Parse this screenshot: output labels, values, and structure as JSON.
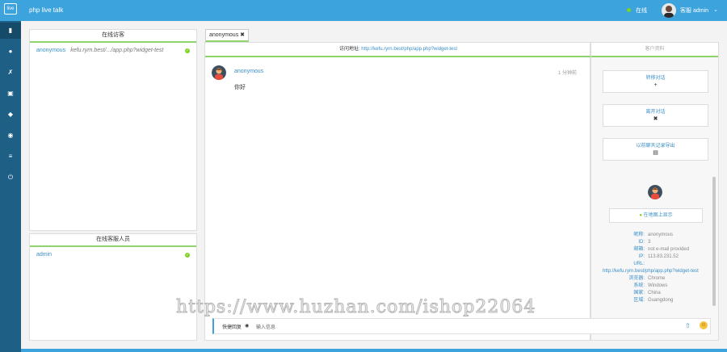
{
  "topbar": {
    "logo": "live",
    "title": "php live talk",
    "status": "在线",
    "user": "客服 admin",
    "status_color": "#7ed321"
  },
  "rail": {
    "icons": [
      "chat-icon",
      "map-marker-icon",
      "wrench-icon",
      "image-icon",
      "tag-icon",
      "eye-icon",
      "list-icon",
      "power-icon"
    ]
  },
  "visitors_panel": {
    "title": "在线访客",
    "items": [
      {
        "name": "anonymous",
        "url": "kefu.ryrn.best/.../app.php?widget-test"
      }
    ]
  },
  "staff_panel": {
    "title": "在线客服人员",
    "items": [
      {
        "name": "admin"
      }
    ]
  },
  "tab": {
    "label": "anonymous",
    "close": "✖"
  },
  "chat": {
    "address_label": "访问地址:",
    "address": "http://kefu.ryrn.best/php/app.php?widget-test",
    "message": {
      "name": "anonymous",
      "time": "1 分钟前",
      "text": "你好"
    }
  },
  "side": {
    "title": "客户资料",
    "buttons": [
      {
        "label": "转移对话",
        "icon": "+"
      },
      {
        "label": "离开对话",
        "icon": "✖"
      },
      {
        "label": "以前聊天记录导出",
        "icon": "▤"
      }
    ],
    "map_button": "在地图上显示",
    "info": [
      {
        "k": "昵称:",
        "v": "anonymous"
      },
      {
        "k": "ID:",
        "v": "3"
      },
      {
        "k": "邮箱:",
        "v": "not e-mail provided"
      },
      {
        "k": "IP:",
        "v": "113.83.231.52"
      },
      {
        "k": "URL:",
        "v": ""
      },
      {
        "k": "",
        "v": "http://kefu.ryrn.best/php/app.php?widget-test"
      },
      {
        "k": "浏览器:",
        "v": "Chrome"
      },
      {
        "k": "系统:",
        "v": "Windows"
      },
      {
        "k": "国家:",
        "v": "China"
      },
      {
        "k": "区域:",
        "v": "Guangdong"
      }
    ]
  },
  "input": {
    "mode_label": "快捷回复",
    "placeholder": "输入信息",
    "upload_icon": "upload-icon",
    "emoji_icon": "emoji-icon"
  },
  "watermark": "https://www.huzhan.com/ishop22064"
}
